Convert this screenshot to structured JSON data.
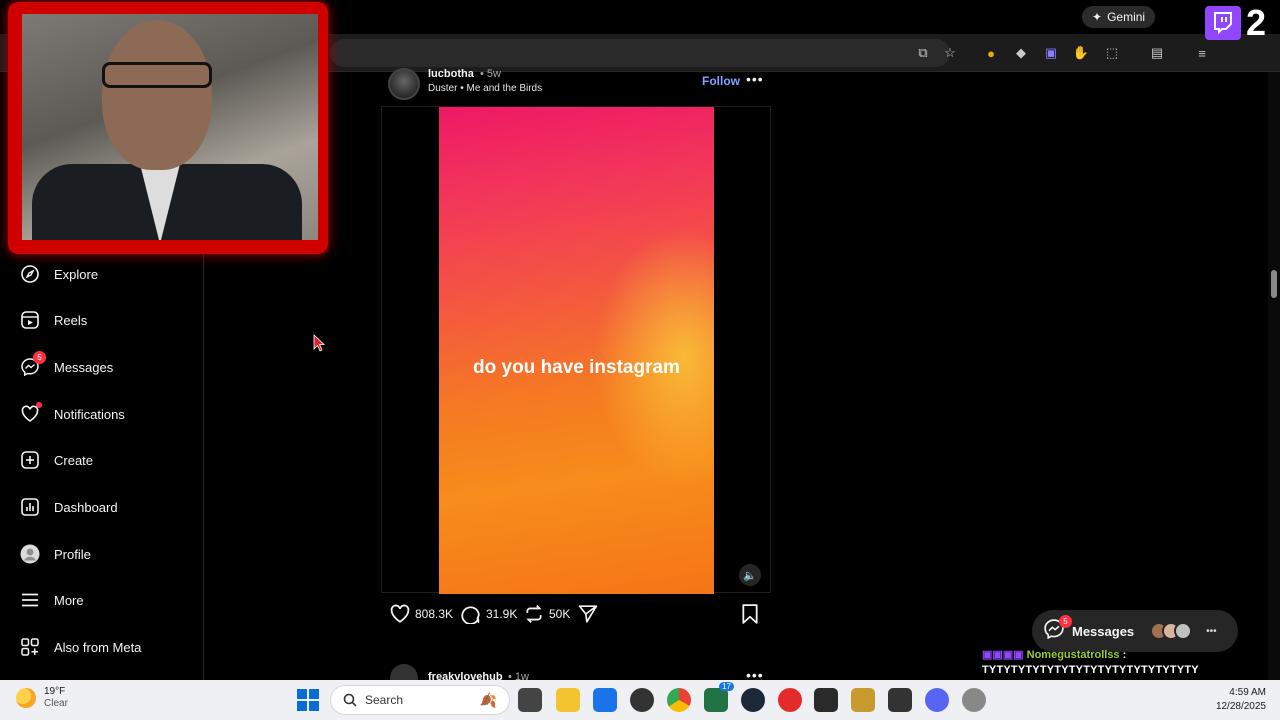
{
  "browser": {
    "gemini_label": "Gemini"
  },
  "sidebar": {
    "items": [
      {
        "label": "Explore",
        "icon": "compass-icon"
      },
      {
        "label": "Reels",
        "icon": "reels-icon"
      },
      {
        "label": "Messages",
        "icon": "messenger-icon",
        "badge": "5"
      },
      {
        "label": "Notifications",
        "icon": "heart-icon"
      },
      {
        "label": "Create",
        "icon": "plus-square-icon"
      },
      {
        "label": "Dashboard",
        "icon": "dashboard-icon"
      },
      {
        "label": "Profile",
        "icon": "profile-avatar-icon"
      },
      {
        "label": "More",
        "icon": "hamburger-icon"
      },
      {
        "label": "Also from Meta",
        "icon": "meta-apps-icon"
      }
    ]
  },
  "post": {
    "username": "lucbotha",
    "time": "• 5w",
    "music": "Duster • Me and the Birds",
    "follow_label": "Follow",
    "reel_text": "do you have instagram",
    "likes": "808.3K",
    "comments": "31.9K",
    "reposts": "50K"
  },
  "next_post": {
    "username": "freakylovehub",
    "time": "• 1w"
  },
  "messages_pill": {
    "label": "Messages",
    "badge": "5"
  },
  "chat": {
    "name": "Nomegustatrollss",
    "separator": " :",
    "message": "TYTYTYTYTYTYTYTYTYTYTYTYTYTYTY"
  },
  "stream_overlay": {
    "counter": "2"
  },
  "taskbar": {
    "temperature": "19°F",
    "condition": "Clear",
    "search_placeholder": "Search",
    "time": "4:59 AM",
    "date": "12/28/2025",
    "steam_badge": "17"
  },
  "colors": {
    "accent_link": "#85a1ff",
    "badge_red": "#ff3040",
    "webcam_frame": "#d10000",
    "twitch_purple": "#9146ff"
  }
}
